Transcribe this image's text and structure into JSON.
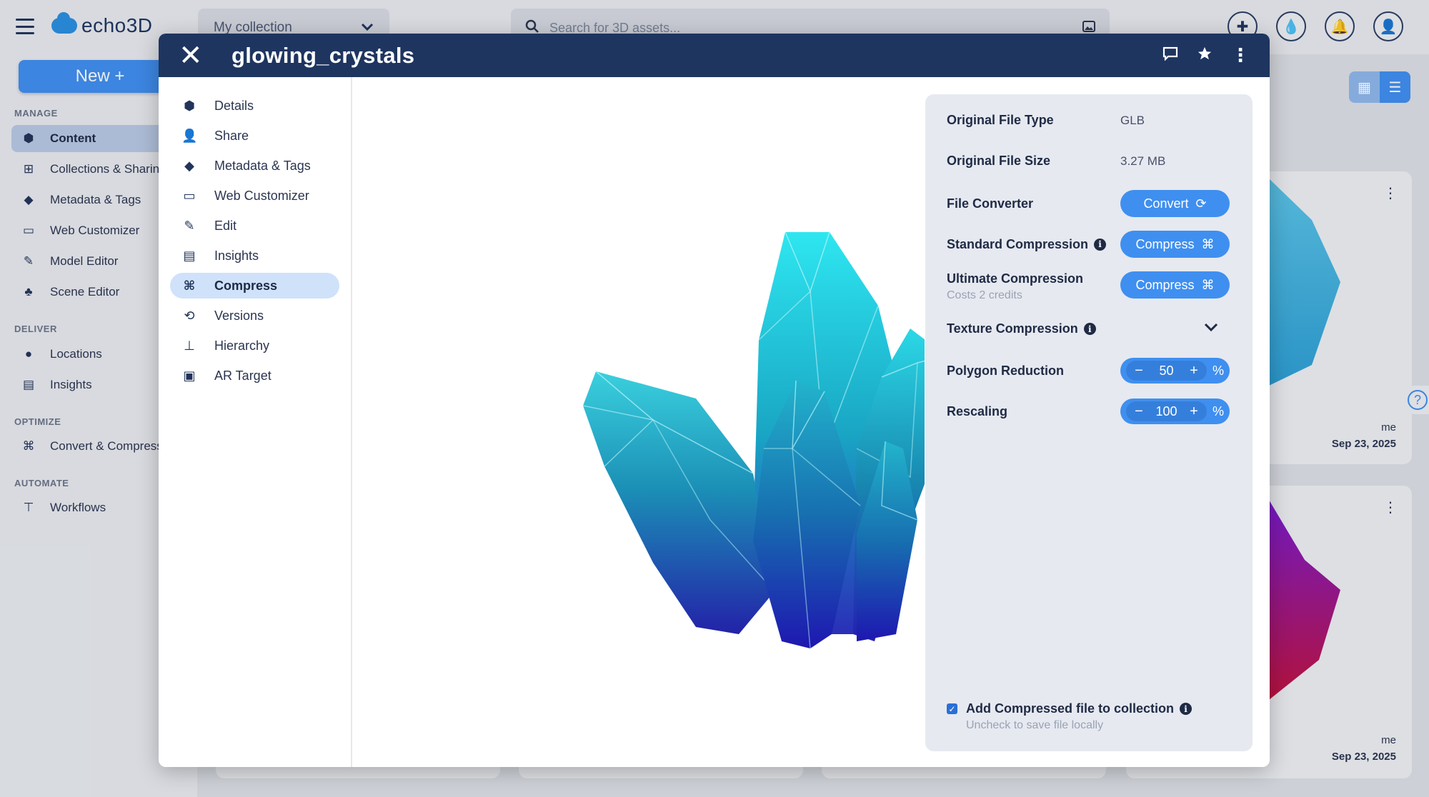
{
  "app": {
    "logo_text": "echo3D",
    "collection_select": "My collection",
    "search_placeholder": "Search for 3D assets...",
    "new_button": "New +"
  },
  "sidebar": {
    "sections": [
      {
        "title": "MANAGE",
        "items": [
          {
            "label": "Content",
            "icon": "cube-icon",
            "active": true
          },
          {
            "label": "Collections & Sharing",
            "icon": "grid-icon"
          },
          {
            "label": "Metadata & Tags",
            "icon": "tag-icon"
          },
          {
            "label": "Web Customizer",
            "icon": "vr-goggles-icon"
          },
          {
            "label": "Model Editor",
            "icon": "pencil-icon"
          },
          {
            "label": "Scene Editor",
            "icon": "shapes-icon"
          }
        ]
      },
      {
        "title": "DELIVER",
        "items": [
          {
            "label": "Locations",
            "icon": "pin-icon"
          },
          {
            "label": "Insights",
            "icon": "chart-icon"
          }
        ]
      },
      {
        "title": "OPTIMIZE",
        "items": [
          {
            "label": "Convert & Compress",
            "icon": "compress-icon"
          }
        ]
      },
      {
        "title": "AUTOMATE",
        "items": [
          {
            "label": "Workflows",
            "icon": "workflow-icon"
          }
        ]
      }
    ]
  },
  "cards": [
    {
      "owner": "me",
      "date": "Sep 23, 2025"
    },
    {
      "owner": "me",
      "date": "Sep 23, 2025"
    }
  ],
  "modal": {
    "title": "glowing_crystals",
    "nav": [
      {
        "label": "Details",
        "icon": "cube-icon"
      },
      {
        "label": "Share",
        "icon": "add-user-icon"
      },
      {
        "label": "Metadata & Tags",
        "icon": "tag-icon"
      },
      {
        "label": "Web Customizer",
        "icon": "vr-goggles-icon"
      },
      {
        "label": "Edit",
        "icon": "pencil-icon"
      },
      {
        "label": "Insights",
        "icon": "chart-icon"
      },
      {
        "label": "Compress",
        "icon": "compress-icon",
        "active": true
      },
      {
        "label": "Versions",
        "icon": "versions-icon"
      },
      {
        "label": "Hierarchy",
        "icon": "hierarchy-icon"
      },
      {
        "label": "AR Target",
        "icon": "qr-icon"
      }
    ],
    "panel": {
      "file_type_label": "Original File Type",
      "file_type_value": "GLB",
      "file_size_label": "Original File Size",
      "file_size_value": "3.27 MB",
      "converter_label": "File Converter",
      "convert_button": "Convert",
      "standard_label": "Standard Compression",
      "standard_button": "Compress",
      "ultimate_label": "Ultimate Compression",
      "ultimate_sub": "Costs 2 credits",
      "ultimate_button": "Compress",
      "texture_label": "Texture Compression",
      "polygon_label": "Polygon Reduction",
      "polygon_value": "50",
      "rescaling_label": "Rescaling",
      "rescaling_value": "100",
      "percent": "%",
      "add_label": "Add Compressed file to collection",
      "add_sub": "Uncheck to save file locally",
      "add_checked": true
    }
  }
}
